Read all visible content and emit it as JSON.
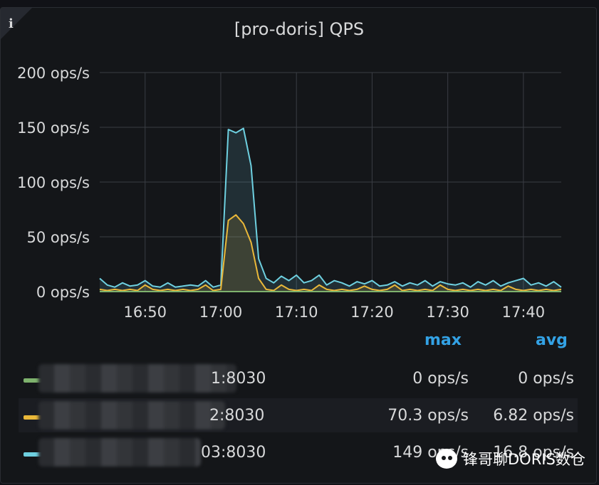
{
  "panel": {
    "title": "[pro-doris] QPS",
    "info_icon": "i",
    "colors": {
      "background": "#141619",
      "grid": "#3a3d44",
      "accent": "#33a2e5"
    }
  },
  "chart_data": {
    "type": "area",
    "xlabel": "",
    "ylabel": "",
    "ylim": [
      0,
      200
    ],
    "xlim": [
      "16:44",
      "17:45"
    ],
    "y_ticks": [
      "0 ops/s",
      "50 ops/s",
      "100 ops/s",
      "150 ops/s",
      "200 ops/s"
    ],
    "x_ticks": [
      "16:50",
      "17:00",
      "17:10",
      "17:20",
      "17:30",
      "17:40"
    ],
    "grid": true,
    "x": [
      "16:44",
      "16:45",
      "16:46",
      "16:47",
      "16:48",
      "16:49",
      "16:50",
      "16:51",
      "16:52",
      "16:53",
      "16:54",
      "16:55",
      "16:56",
      "16:57",
      "16:58",
      "16:59",
      "17:00",
      "17:01",
      "17:02",
      "17:03",
      "17:04",
      "17:05",
      "17:06",
      "17:07",
      "17:08",
      "17:09",
      "17:10",
      "17:11",
      "17:12",
      "17:13",
      "17:14",
      "17:15",
      "17:16",
      "17:17",
      "17:18",
      "17:19",
      "17:20",
      "17:21",
      "17:22",
      "17:23",
      "17:24",
      "17:25",
      "17:26",
      "17:27",
      "17:28",
      "17:29",
      "17:30",
      "17:31",
      "17:32",
      "17:33",
      "17:34",
      "17:35",
      "17:36",
      "17:37",
      "17:38",
      "17:39",
      "17:40",
      "17:41",
      "17:42",
      "17:43",
      "17:44",
      "17:45"
    ],
    "series": [
      {
        "color": "#7eb26d",
        "values": [
          0,
          0,
          0,
          0,
          0,
          0,
          0,
          0,
          0,
          0,
          0,
          0,
          0,
          0,
          0,
          0,
          0,
          0,
          0,
          0,
          0,
          0,
          0,
          0,
          0,
          0,
          0,
          0,
          0,
          0,
          0,
          0,
          0,
          0,
          0,
          0,
          0,
          0,
          0,
          0,
          0,
          0,
          0,
          0,
          0,
          0,
          0,
          0,
          0,
          0,
          0,
          0,
          0,
          0,
          0,
          0,
          0,
          0,
          0,
          0,
          0,
          0
        ]
      },
      {
        "color": "#eab839",
        "values": [
          2,
          1,
          2,
          1,
          2,
          1,
          6,
          2,
          1,
          2,
          1,
          2,
          1,
          2,
          6,
          1,
          2,
          65,
          70,
          62,
          45,
          12,
          2,
          1,
          6,
          2,
          1,
          2,
          1,
          6,
          2,
          1,
          2,
          1,
          2,
          5,
          2,
          1,
          2,
          6,
          1,
          2,
          1,
          2,
          1,
          6,
          2,
          1,
          2,
          1,
          2,
          1,
          2,
          1,
          5,
          2,
          1,
          2,
          1,
          2,
          1,
          2
        ]
      },
      {
        "color": "#6ed0e0",
        "values": [
          12,
          6,
          4,
          8,
          5,
          6,
          10,
          5,
          4,
          8,
          4,
          5,
          6,
          5,
          10,
          4,
          6,
          148,
          145,
          149,
          115,
          30,
          12,
          8,
          14,
          10,
          15,
          8,
          10,
          15,
          6,
          10,
          8,
          5,
          9,
          7,
          10,
          5,
          6,
          9,
          5,
          8,
          6,
          10,
          5,
          9,
          7,
          6,
          8,
          4,
          9,
          6,
          10,
          5,
          8,
          10,
          12,
          6,
          8,
          5,
          9,
          4
        ]
      }
    ]
  },
  "legend": {
    "max_header": "max",
    "avg_header": "avg",
    "rows": [
      {
        "name": "1:8030",
        "max": "0 ops/s",
        "avg": "0 ops/s",
        "color": "#7eb26d"
      },
      {
        "name": "2:8030",
        "max": "70.3 ops/s",
        "avg": "6.82 ops/s",
        "color": "#eab839"
      },
      {
        "name": "03:8030",
        "max": "149 ops/s",
        "avg": "16.8 ops/s",
        "color": "#6ed0e0"
      }
    ]
  },
  "watermark": {
    "text": "锋哥聊DORIS数仓",
    "icon": "wechat-icon"
  }
}
